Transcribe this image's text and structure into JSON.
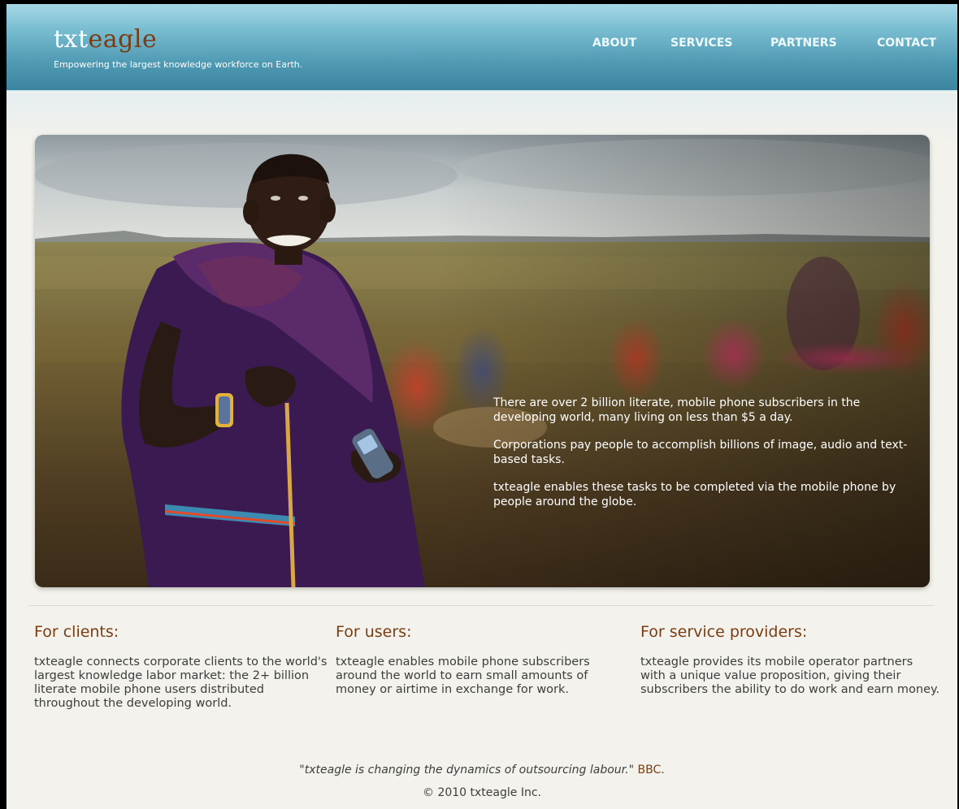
{
  "header": {
    "logo_prefix": "txt",
    "logo_suffix": "eagle",
    "tagline": "Empowering the largest knowledge workforce on Earth.",
    "nav": [
      "ABOUT",
      "SERVICES",
      "PARTNERS",
      "CONTACT"
    ]
  },
  "hero": {
    "paragraphs": [
      "There are over 2 billion literate, mobile phone subscribers in the developing world, many living on less than $5 a day.",
      "Corporations pay people to accomplish billions of image, audio and text-based tasks.",
      "txteagle enables these tasks to be completed via the mobile phone by people around the globe."
    ]
  },
  "columns": [
    {
      "title": "For clients:",
      "body": "txteagle connects corporate clients to the world's largest knowledge labor market: the 2+ billion literate mobile phone users distributed throughout the developing world."
    },
    {
      "title": "For users:",
      "body": "txteagle enables mobile phone subscribers around the world to earn small amounts of money or airtime in exchange for work."
    },
    {
      "title": "For service providers:",
      "body": "txteagle provides its mobile operator partners with a unique value proposition, giving their subscribers the ability to do work and earn money."
    }
  ],
  "quote": {
    "text": "txteagle is changing the dynamics of outsourcing labour.",
    "source": "BBC"
  },
  "footer": {
    "copyright": "© 2010 txteagle Inc."
  },
  "colors": {
    "brand_brown": "#7a3d12",
    "header_blue": "#4e98b2",
    "page_bg": "#f3f2ec"
  }
}
